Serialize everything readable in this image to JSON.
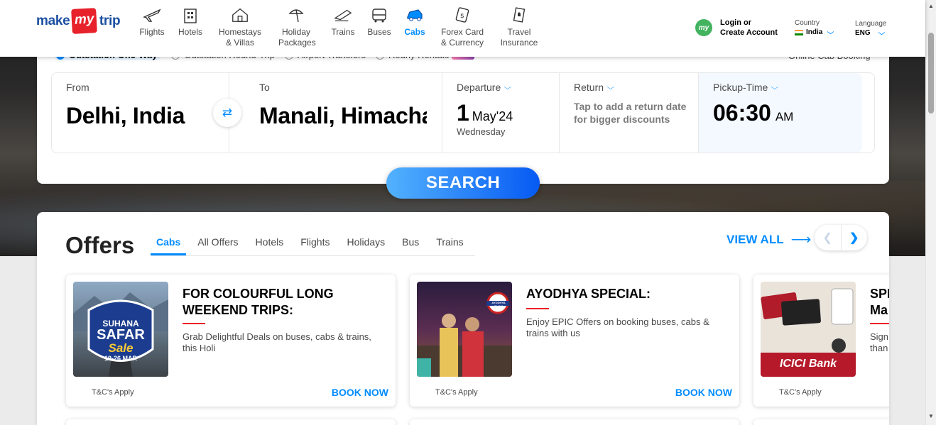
{
  "logo": {
    "part1": "make",
    "part2": "my",
    "part3": "trip"
  },
  "nav": [
    {
      "label": "Flights",
      "icon": "flight-icon"
    },
    {
      "label": "Hotels",
      "icon": "hotel-icon"
    },
    {
      "label": "Homestays & Villas",
      "icon": "homestay-icon"
    },
    {
      "label": "Holiday Packages",
      "icon": "holiday-icon"
    },
    {
      "label": "Trains",
      "icon": "train-icon"
    },
    {
      "label": "Buses",
      "icon": "bus-icon"
    },
    {
      "label": "Cabs",
      "icon": "cab-icon",
      "active": true
    },
    {
      "label": "Forex Card & Currency",
      "icon": "forex-icon"
    },
    {
      "label": "Travel Insurance",
      "icon": "insurance-icon"
    }
  ],
  "account": {
    "avatar_text": "my",
    "login_line1": "Login or",
    "login_line2": "Create Account"
  },
  "country": {
    "label": "Country",
    "value": "India"
  },
  "language": {
    "label": "Language",
    "value": "ENG"
  },
  "trip_options": [
    {
      "label": "Outstation One-Way",
      "selected": true
    },
    {
      "label": "Outstation Round-Trip",
      "selected": false
    },
    {
      "label": "Airport Transfers",
      "selected": false
    },
    {
      "label": "Hourly Rentals",
      "selected": false
    }
  ],
  "new_tag": "new",
  "online_booking": "Online Cab Booking",
  "search": {
    "from_label": "From",
    "from_value": "Delhi, India",
    "to_label": "To",
    "to_value": "Manali, Himachal Pradesh",
    "departure_label": "Departure",
    "departure_day": "1",
    "departure_month": "May'24",
    "departure_weekday": "Wednesday",
    "return_label": "Return",
    "return_hint": "Tap to add a return date for bigger discounts",
    "pickup_label": "Pickup-Time",
    "pickup_time": "06:30",
    "pickup_ampm": "AM",
    "button": "SEARCH"
  },
  "offers": {
    "title": "Offers",
    "tabs": [
      "Cabs",
      "All Offers",
      "Hotels",
      "Flights",
      "Holidays",
      "Bus",
      "Trains"
    ],
    "view_all": "VIEW ALL",
    "cards": [
      {
        "title": "FOR COLOURFUL LONG WEEKEND TRIPS:",
        "desc": "Grab Delightful Deals on buses, cabs & trains, this Holi",
        "tnc": "T&C's Apply",
        "cta": "BOOK NOW",
        "img_text1": "SUHANA",
        "img_text2": "SAFAR",
        "img_text3": "Sale",
        "img_text4": "19-26 MAR"
      },
      {
        "title": "AYODHYA SPECIAL:",
        "desc": "Enjoy EPIC Offers on booking buses, cabs & trains with us",
        "tnc": "T&C's Apply",
        "cta": "BOOK NOW",
        "img_text1": "AYODHYA DHAM"
      },
      {
        "title": "SPECIAL Ma",
        "desc": "Sign than",
        "tnc": "T&C's Apply",
        "cta": "",
        "img_text1": "ICICI Bank"
      }
    ]
  },
  "colors": {
    "accent": "#008cff",
    "brand_red": "#e7222b",
    "brand_blue": "#1a4fa1"
  }
}
